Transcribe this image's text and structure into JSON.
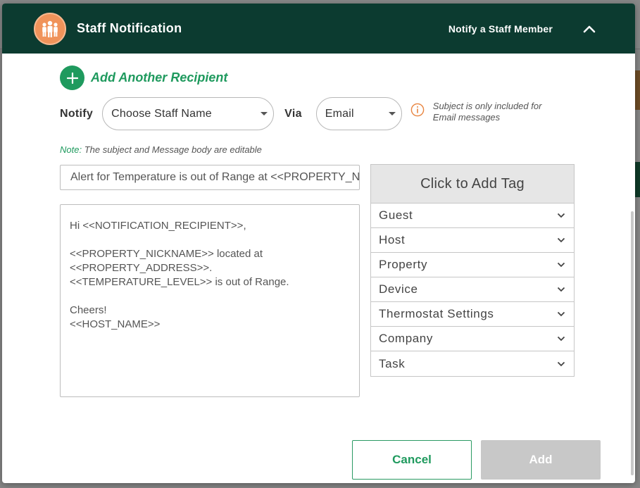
{
  "header": {
    "title": "Staff Notification",
    "subtitle": "Notify a Staff Member"
  },
  "recipient": {
    "add_label": "Add Another Recipient"
  },
  "notify": {
    "label": "Notify",
    "staff_select_value": "Choose Staff Name",
    "via_label": "Via",
    "via_select_value": "Email",
    "info_text": "Subject is only included for Email messages"
  },
  "note": {
    "label": "Note:",
    "text": " The subject and Message body are editable"
  },
  "subject": {
    "value": "Alert for Temperature is out of Range at <<PROPERTY_NICKNAME>>"
  },
  "message": {
    "lines": [
      "Hi <<NOTIFICATION_RECIPIENT>>,",
      "",
      "<<PROPERTY_NICKNAME>> located at <<PROPERTY_ADDRESS>>.<<TEMPERATURE_LEVEL>> is out of Range.",
      "",
      "Cheers!",
      "<<HOST_NAME>>"
    ]
  },
  "tags": {
    "header": "Click to Add Tag",
    "items": [
      "Guest",
      "Host",
      "Property",
      "Device",
      "Thermostat Settings",
      "Company",
      "Task"
    ]
  },
  "actions": {
    "cancel_label": "Cancel",
    "add_label": "Add"
  },
  "colors": {
    "header_bg": "#0c3b30",
    "accent_green": "#1f9a5e",
    "avatar_orange": "#f0935a",
    "info_orange": "#e8843f",
    "disabled_gray": "#c8c8c8"
  },
  "icons": {
    "avatar": "staff-group-icon",
    "collapse": "chevron-up-icon",
    "add": "plus-icon",
    "info": "info-icon",
    "tag_expand": "chevron-down-icon"
  }
}
